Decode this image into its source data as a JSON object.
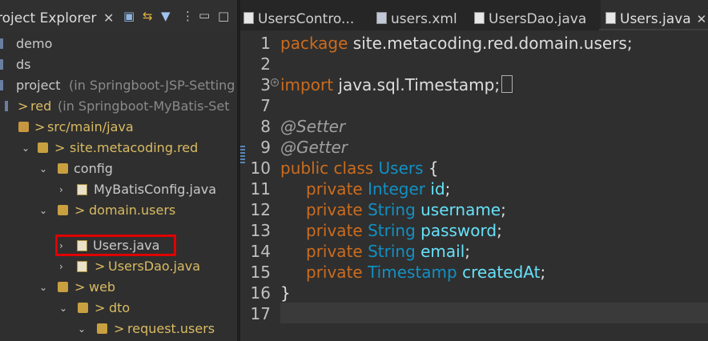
{
  "explorer": {
    "title": "roject Explorer",
    "close": "✕",
    "toolbar": [
      "collapse-all-icon",
      "link-with-editor-icon",
      "filter-icon",
      "view-menu-icon",
      "minimize-icon",
      "maximize-icon"
    ],
    "tree": [
      {
        "label": "demo",
        "qualifier": ""
      },
      {
        "label": "ds",
        "qualifier": ""
      },
      {
        "label": "project",
        "qualifier": "(in Springboot-JSP-Setting"
      },
      {
        "label": "red",
        "qualifier": "(in Springboot-MyBatis-Set"
      },
      {
        "label": "src/main/java",
        "qualifier": ""
      },
      {
        "label": "site.metacoding.red",
        "qualifier": ""
      },
      {
        "label": "config",
        "qualifier": ""
      },
      {
        "label": "MyBatisConfig.java",
        "qualifier": ""
      },
      {
        "label": "domain.users",
        "qualifier": ""
      },
      {
        "label": "Users.java",
        "qualifier": ""
      },
      {
        "label": "UsersDao.java",
        "qualifier": ""
      },
      {
        "label": "web",
        "qualifier": ""
      },
      {
        "label": "dto",
        "qualifier": ""
      },
      {
        "label": "request.users",
        "qualifier": ""
      }
    ],
    "decorator": ">"
  },
  "tabs": [
    {
      "label": "UsersContro..."
    },
    {
      "label": "users.xml"
    },
    {
      "label": "UsersDao.java"
    },
    {
      "label": "Users.java",
      "close": "✕"
    }
  ],
  "editor": {
    "line_numbers": [
      "1",
      "2",
      "3",
      "7",
      "8",
      "9",
      "10",
      "11",
      "12",
      "13",
      "14",
      "15",
      "16",
      "17"
    ],
    "code": {
      "l1_kw": "package",
      "l1_rest": " site.metacoding.red.domain.users;",
      "l3_kw": "import",
      "l3_rest": " java.sql.Timestamp;",
      "l8": "@Setter",
      "l9": "@Getter",
      "l10_kw": "public class",
      "l10_ty": " Users",
      "l10_rest": " {",
      "fields": [
        {
          "kw": "private",
          "type": "Integer",
          "name": "id"
        },
        {
          "kw": "private",
          "type": "String",
          "name": "username"
        },
        {
          "kw": "private",
          "type": "String",
          "name": "password"
        },
        {
          "kw": "private",
          "type": "String",
          "name": "email"
        },
        {
          "kw": "private",
          "type": "Timestamp",
          "name": "createdAt"
        }
      ],
      "semicolon": ";",
      "l16": "}"
    }
  },
  "colors": {
    "keyword": "#cc6c1d",
    "type": "#1290c3",
    "field": "#66e1f8",
    "highlight": "#e00000"
  }
}
